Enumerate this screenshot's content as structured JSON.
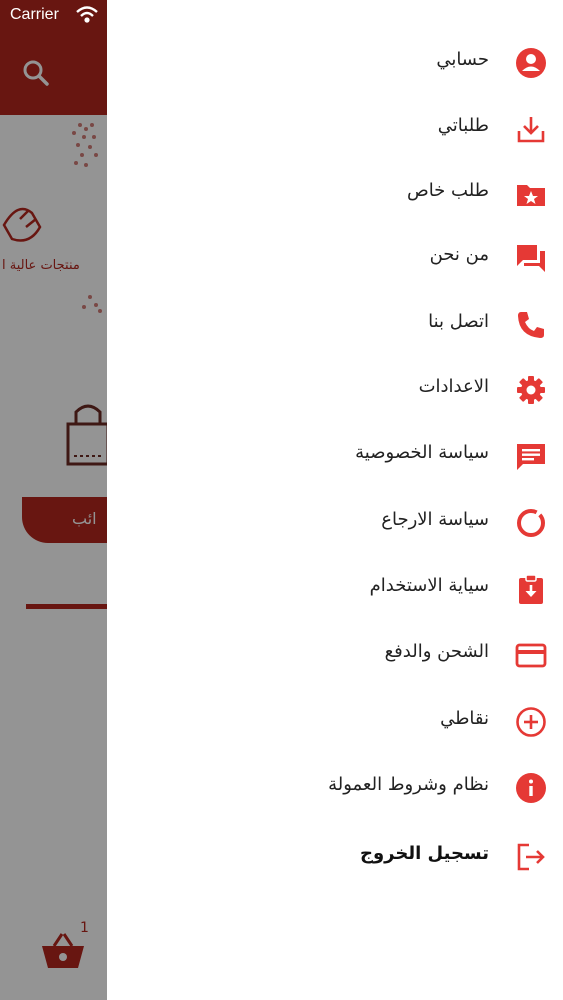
{
  "status_bar": {
    "carrier": "Carrier"
  },
  "background": {
    "banner_text": "منتجات عالية ا",
    "button_text": "ائب",
    "cart_count": "1"
  },
  "drawer": {
    "items": [
      {
        "label": "حسابي",
        "icon": "account-circle-icon"
      },
      {
        "label": "طلباتي",
        "icon": "download-tray-icon"
      },
      {
        "label": "طلب خاص",
        "icon": "folder-star-icon"
      },
      {
        "label": "من نحن",
        "icon": "chat-bubbles-icon"
      },
      {
        "label": "اتصل بنا",
        "icon": "phone-icon"
      },
      {
        "label": "الاعدادات",
        "icon": "gear-icon"
      },
      {
        "label": "سياسة الخصوصية",
        "icon": "message-lines-icon"
      },
      {
        "label": "سياسة الارجاع",
        "icon": "donut-icon"
      },
      {
        "label": "سياية الاستخدام",
        "icon": "clipboard-download-icon"
      },
      {
        "label": "الشحن والدفع",
        "icon": "credit-card-icon"
      },
      {
        "label": "نقاطي",
        "icon": "plus-circle-icon"
      },
      {
        "label": "نظام وشروط العمولة",
        "icon": "info-icon"
      },
      {
        "label": "تسجيل الخروج",
        "icon": "logout-icon"
      }
    ]
  },
  "colors": {
    "accent": "#e53935",
    "header": "#b3261e"
  }
}
